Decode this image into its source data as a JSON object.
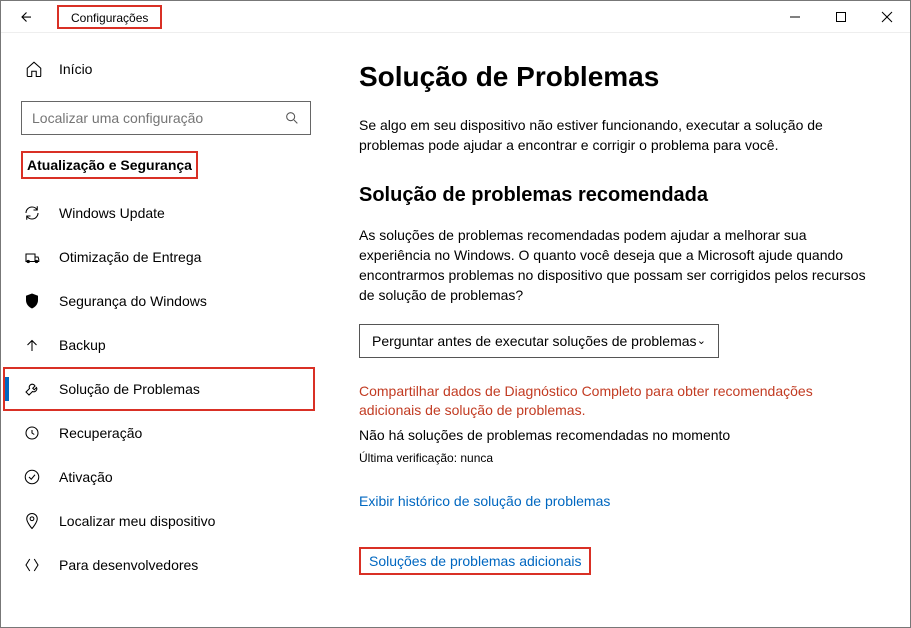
{
  "titlebar": {
    "title": "Configurações"
  },
  "sidebar": {
    "home_label": "Início",
    "search_placeholder": "Localizar uma configuração",
    "category_label": "Atualização e Segurança",
    "items": [
      {
        "label": "Windows Update"
      },
      {
        "label": "Otimização de Entrega"
      },
      {
        "label": "Segurança do Windows"
      },
      {
        "label": "Backup"
      },
      {
        "label": "Solução de Problemas"
      },
      {
        "label": "Recuperação"
      },
      {
        "label": "Ativação"
      },
      {
        "label": "Localizar meu dispositivo"
      },
      {
        "label": "Para desenvolvedores"
      }
    ]
  },
  "main": {
    "title": "Solução de Problemas",
    "intro": "Se algo em seu dispositivo não estiver funcionando, executar a solução de problemas pode ajudar a encontrar e corrigir o problema para você.",
    "section_title": "Solução de problemas recomendada",
    "section_desc": "As soluções de problemas recomendadas podem ajudar a melhorar sua experiência no Windows. O quanto você deseja que a Microsoft ajude quando encontrarmos problemas no dispositivo que possam ser corrigidos pelos recursos de solução de problemas?",
    "select_value": "Perguntar antes de executar soluções de problemas",
    "warning": "Compartilhar dados de Diagnóstico Completo para obter recomendações adicionais de solução de problemas.",
    "status": "Não há soluções de problemas recomendadas no momento",
    "last_check": "Última verificação: nunca",
    "history_link": "Exibir histórico de solução de problemas",
    "additional_link": "Soluções de problemas adicionais"
  }
}
